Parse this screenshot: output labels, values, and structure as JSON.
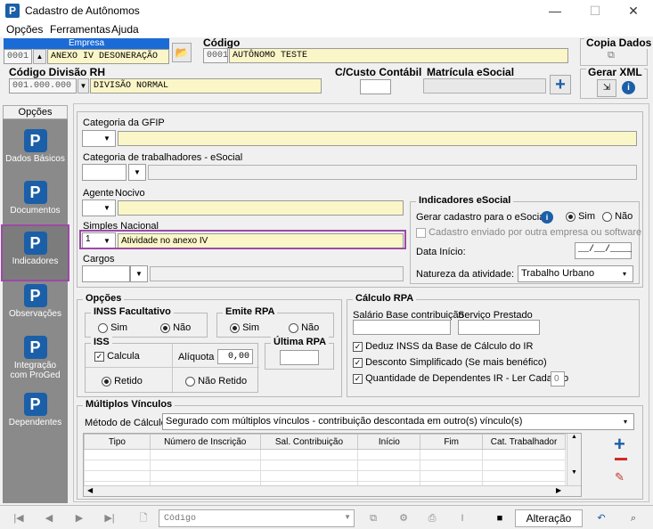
{
  "window": {
    "title": "Cadastro de Autônomos",
    "min": "—",
    "max": "☐",
    "close": "✕"
  },
  "menu": [
    "Opções",
    "Ferramentas",
    "Ajuda"
  ],
  "empresa": {
    "label": "Empresa",
    "code": "0001",
    "name": "ANEXO IV DESONERAÇÃO"
  },
  "codigo": {
    "label": "Código",
    "code": "0001",
    "name": "AUTÔNOMO TESTE"
  },
  "copia_dados": {
    "label": "Copia Dados"
  },
  "divisao": {
    "label": "Código Divisão RH",
    "code": "001.000.000",
    "name": "DIVISÃO NORMAL"
  },
  "ccusto": {
    "label": "C/Custo Contábil"
  },
  "matricula": {
    "label": "Matrícula eSocial"
  },
  "gerar_xml": {
    "label": "Gerar XML"
  },
  "sidebar": {
    "header": "Opções",
    "items": [
      "Dados Básicos",
      "Documentos",
      "Indicadores",
      "Observações",
      "Integração com ProGed",
      "Dependentes"
    ]
  },
  "form": {
    "categoria_gfip": "Categoria da GFIP",
    "categoria_esocial": "Categoria de trabalhadores - eSocial",
    "agente": "Agente",
    "nocivo": "Nocivo",
    "simples": {
      "label": "Simples Nacional",
      "code": "1",
      "value": "Atividade no anexo IV"
    },
    "cargos": "Cargos"
  },
  "indicadores": {
    "title": "Indicadores eSocial",
    "gerar_label": "Gerar cadastro para o eSocial:",
    "sim": "Sim",
    "nao": "Não",
    "enviado": "Cadastro enviado por outra empresa ou software",
    "data_inicio": "Data Início:",
    "data_value": "__/__/____",
    "natureza_label": "Natureza da atividade:",
    "natureza_value": "Trabalho Urbano"
  },
  "opcoes": {
    "title": "Opções",
    "inss_title": "INSS Facultativo",
    "emite_title": "Emite RPA",
    "iss_title": "ISS",
    "calcula": "Calcula",
    "aliquota": "Alíquota",
    "aliquota_value": "0,00",
    "retido": "Retido",
    "nao_retido": "Não Retido",
    "ultima_rpa": "Última RPA",
    "sim": "Sim",
    "nao": "Não"
  },
  "calculo": {
    "title": "Cálculo RPA",
    "salario": "Salário Base contribuição",
    "servico": "Serviço Prestado",
    "deduz": "Deduz INSS da Base de Cálculo do IR",
    "desconto": "Desconto Simplificado (Se mais benéfico)",
    "dependentes": "Quantidade de Dependentes IR - Ler Cadastro",
    "dependentes_value": "0"
  },
  "multiplos": {
    "title": "Múltiplos Vínculos",
    "metodo_label": "Método de Cálculo",
    "metodo_value": "Segurado com múltiplos vínculos - contribuição descontada em outro(s) vínculo(s)",
    "columns": [
      "Tipo",
      "Número de Inscrição",
      "Sal. Contribuição",
      "Início",
      "Fim",
      "Cat. Trabalhador"
    ]
  },
  "statusbar": {
    "search_placeholder": "Código",
    "mode": "Alteração"
  },
  "colors": {
    "accent": "#1b5fa8",
    "field": "#fbf6c8",
    "highlight": "#9c4aa6"
  }
}
